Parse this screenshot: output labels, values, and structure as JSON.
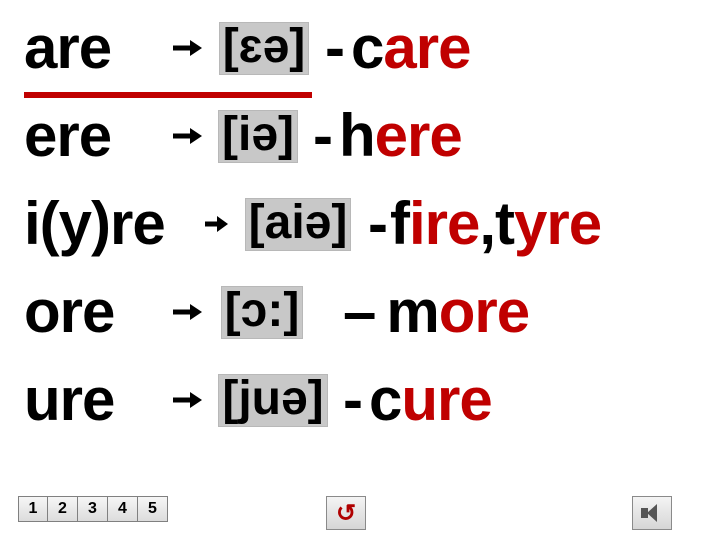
{
  "rows": [
    {
      "pattern": "are",
      "ipa": "[ɛə]",
      "sep": "- ",
      "ex": [
        {
          "t": "c",
          "c": "plain"
        },
        {
          "t": "are",
          "c": "hl"
        }
      ]
    },
    {
      "pattern": "ere",
      "ipa": "[iə]",
      "sep": "- ",
      "ex": [
        {
          "t": "h",
          "c": "plain"
        },
        {
          "t": "ere",
          "c": "hl"
        }
      ]
    },
    {
      "pattern": "i(y)re",
      "ipa": "[aiə]",
      "sep": "-",
      "ex": [
        {
          "t": "f",
          "c": "plain"
        },
        {
          "t": "ire",
          "c": "hl"
        },
        {
          "t": ",t",
          "c": "plain"
        },
        {
          "t": "yre",
          "c": "hl"
        }
      ]
    },
    {
      "pattern": "ore",
      "ipa": "[ɔ:]",
      "sep": "– ",
      "ex": [
        {
          "t": "m",
          "c": "plain"
        },
        {
          "t": "ore",
          "c": "hl"
        }
      ]
    },
    {
      "pattern": "ure",
      "ipa": "[juə]",
      "sep": "- ",
      "ex": [
        {
          "t": "c",
          "c": "plain"
        },
        {
          "t": "ure",
          "c": "hl"
        }
      ]
    }
  ],
  "nav": {
    "pages": [
      "1",
      "2",
      "3",
      "4",
      "5"
    ]
  },
  "icons": {
    "back": "back-uturn-icon",
    "sound": "speaker-icon"
  },
  "colors": {
    "highlight": "#c00000",
    "ipa_bg": "#c8c8c8"
  }
}
